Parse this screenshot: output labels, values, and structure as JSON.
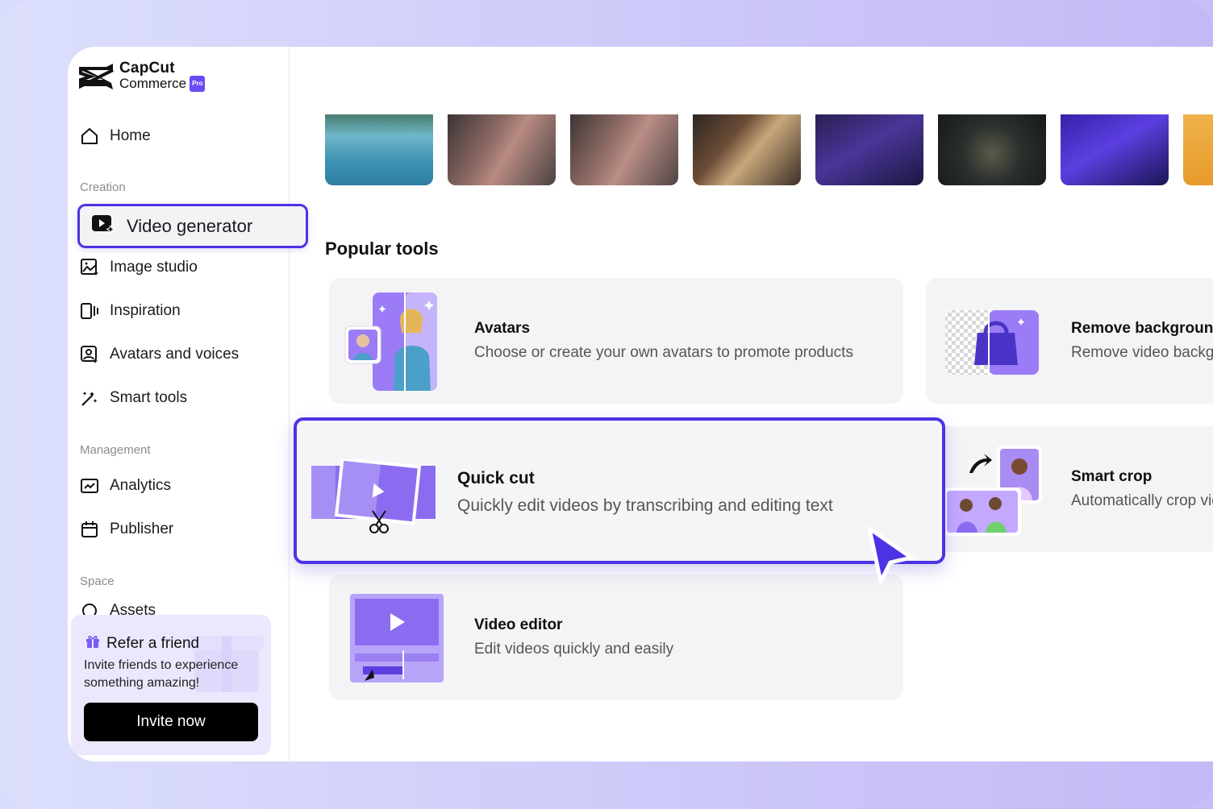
{
  "brand": {
    "line1": "CapCut",
    "line2": "Commerce",
    "badge": "Pro"
  },
  "sidebar": {
    "home": "Home",
    "section_creation": "Creation",
    "video_generator": "Video generator",
    "image_studio": "Image studio",
    "inspiration": "Inspiration",
    "avatars_voices": "Avatars and voices",
    "smart_tools": "Smart tools",
    "section_management": "Management",
    "analytics": "Analytics",
    "publisher": "Publisher",
    "section_space": "Space",
    "space_partial": "Assets"
  },
  "refer": {
    "title": "Refer a friend",
    "description": "Invite friends to experience something amazing!",
    "button": "Invite now"
  },
  "main": {
    "popular_title": "Popular tools",
    "tools": {
      "avatars": {
        "name": "Avatars",
        "desc": "Choose or create your own avatars to promote products"
      },
      "remove_bg": {
        "name": "Remove background",
        "desc": "Remove video background"
      },
      "quick_cut": {
        "name": "Quick cut",
        "desc": "Quickly edit videos by transcribing and editing text"
      },
      "smart_crop": {
        "name": "Smart crop",
        "desc": "Automatically crop videos"
      },
      "video_editor": {
        "name": "Video editor",
        "desc": "Edit videos quickly and easily"
      }
    }
  },
  "colors": {
    "accent": "#4b34e6",
    "purple": "#8b6cf0",
    "card_bg": "#f4f4f6"
  }
}
